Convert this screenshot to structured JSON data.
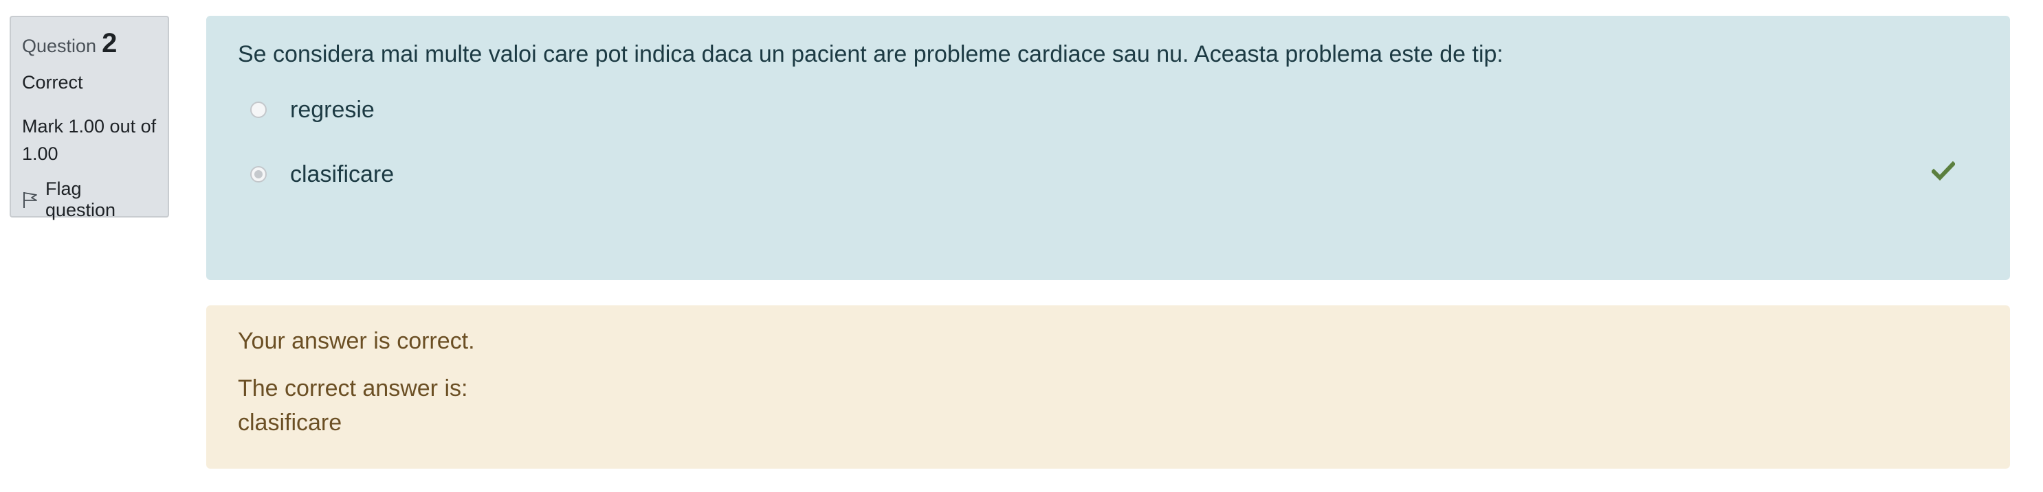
{
  "info": {
    "question_word": "Question",
    "question_number": "2",
    "state": "Correct",
    "grade": "Mark 1.00 out of 1.00",
    "flag_label": "Flag question",
    "flag_icon": "flag-outline-icon"
  },
  "question": {
    "text": "Se considera mai multe valoi care pot indica daca un pacient are probleme cardiace sau nu. Aceasta problema este de tip:",
    "options": [
      {
        "label": "regresie",
        "selected": false
      },
      {
        "label": "clasificare",
        "selected": true
      }
    ],
    "correct_icon": "check-icon",
    "correct_color": "#5b7f3e"
  },
  "feedback": {
    "general": "Your answer is correct.",
    "right_answer_heading": "The correct answer is:",
    "right_answer_value": "clasificare"
  },
  "colors": {
    "formulation_bg": "#d3e6ea",
    "outcome_bg": "#f7eedc",
    "info_bg": "#dee2e6"
  }
}
